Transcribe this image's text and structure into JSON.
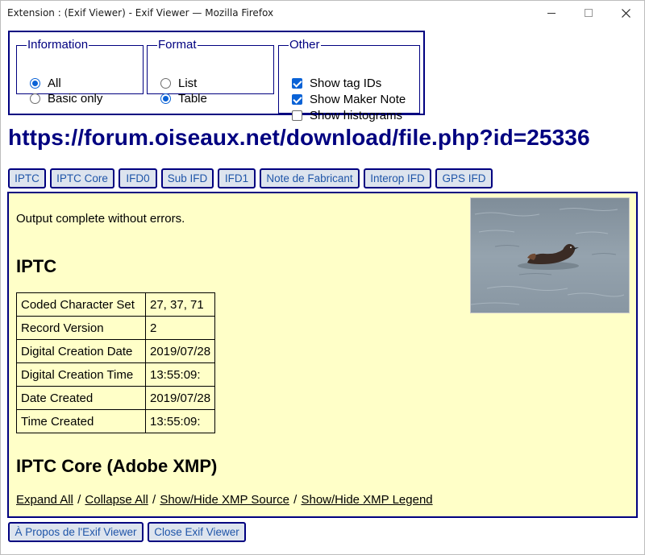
{
  "window": {
    "title": "Extension : (Exif Viewer) - Exif Viewer — Mozilla Firefox",
    "controls": {
      "minimize": "minimize-icon",
      "maximize": "maximize-icon",
      "close": "close-icon"
    }
  },
  "options": {
    "information": {
      "legend": "Information",
      "items": [
        {
          "label": "All",
          "selected": true
        },
        {
          "label": "Basic only",
          "selected": false
        }
      ]
    },
    "format": {
      "legend": "Format",
      "items": [
        {
          "label": "List",
          "selected": false
        },
        {
          "label": "Table",
          "selected": true
        }
      ]
    },
    "other": {
      "legend": "Other",
      "items": [
        {
          "label": "Show tag IDs",
          "checked": true
        },
        {
          "label": "Show Maker Note",
          "checked": true
        },
        {
          "label": "Show histograms",
          "checked": false
        }
      ]
    }
  },
  "url": "https://forum.oiseaux.net/download/file.php?id=25336",
  "tabs": [
    "IPTC",
    "IPTC Core",
    "IFD0",
    "Sub IFD",
    "IFD1",
    "Note de Fabricant",
    "Interop IFD",
    "GPS IFD"
  ],
  "content": {
    "status": "Output complete without errors.",
    "iptc_heading": "IPTC",
    "iptc_rows": [
      {
        "key": "Coded Character Set",
        "value": "27, 37, 71"
      },
      {
        "key": "Record Version",
        "value": "2"
      },
      {
        "key": "Digital Creation Date",
        "value": "2019/07/28"
      },
      {
        "key": "Digital Creation Time",
        "value": "13:55:09:"
      },
      {
        "key": "Date Created",
        "value": "2019/07/28"
      },
      {
        "key": "Time Created",
        "value": "13:55:09:"
      }
    ],
    "xmp_heading": "IPTC Core (Adobe XMP)",
    "links": [
      "Expand All",
      "Collapse All",
      "Show/Hide XMP Source",
      "Show/Hide XMP Legend"
    ],
    "link_separator": "/"
  },
  "buttons": {
    "about": "À Propos de l'Exif Viewer",
    "close": "Close Exif Viewer"
  },
  "colors": {
    "accent": "#000080",
    "link_text": "#1f55a8",
    "content_bg": "#ffffc8",
    "control_blue": "#0a62d6"
  }
}
